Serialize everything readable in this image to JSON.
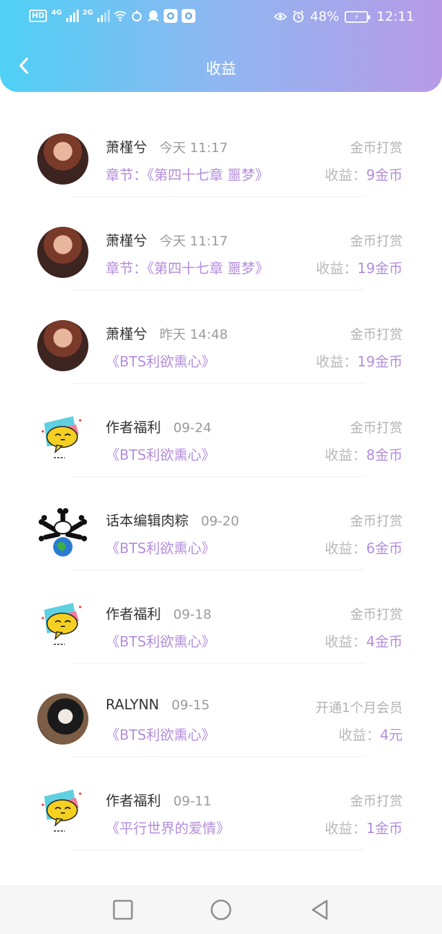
{
  "status_bar": {
    "left_tags": [
      "HD",
      "4G",
      "2G"
    ],
    "battery": "48%",
    "time": "12:11"
  },
  "header": {
    "title": "收益"
  },
  "items": [
    {
      "avatar": "photo-woman-1",
      "name": "萧槿兮",
      "time": "今天 11:17",
      "type": "金币打赏",
      "book": "章节：《第四十七章 噩梦》",
      "earn_label": "收益：",
      "earn_amount": "9金币"
    },
    {
      "avatar": "photo-woman-1",
      "name": "萧槿兮",
      "time": "今天 11:17",
      "type": "金币打赏",
      "book": "章节：《第四十七章 噩梦》",
      "earn_label": "收益：",
      "earn_amount": "19金币"
    },
    {
      "avatar": "photo-woman-1",
      "name": "萧槿兮",
      "time": "昨天 14:48",
      "type": "金币打赏",
      "book": "《BTS利欲熏心》",
      "earn_label": "收益：",
      "earn_amount": "19金币"
    },
    {
      "avatar": "yellow-sticker",
      "name": "作者福利",
      "time": "09-24",
      "type": "金币打赏",
      "book": "《BTS利欲熏心》",
      "earn_label": "收益：",
      "earn_amount": "8金币"
    },
    {
      "avatar": "earth-bones",
      "name": "话本编辑肉粽",
      "time": "09-20",
      "type": "金币打赏",
      "book": "《BTS利欲熏心》",
      "earn_label": "收益：",
      "earn_amount": "6金币"
    },
    {
      "avatar": "yellow-sticker",
      "name": "作者福利",
      "time": "09-18",
      "type": "金币打赏",
      "book": "《BTS利欲熏心》",
      "earn_label": "收益：",
      "earn_amount": "4金币"
    },
    {
      "avatar": "photo-woman-2",
      "name": "RALYNN",
      "time": "09-15",
      "type": "开通1个月会员",
      "book": "《BTS利欲熏心》",
      "earn_label": "收益：",
      "earn_amount": "4元"
    },
    {
      "avatar": "yellow-sticker",
      "name": "作者福利",
      "time": "09-11",
      "type": "金币打赏",
      "book": "《平行世界的爱情》",
      "earn_label": "收益：",
      "earn_amount": "1金币"
    }
  ],
  "colors": {
    "accent_purple": "#b38ddb",
    "header_gradient_start": "#4fd0f5",
    "header_gradient_end": "#b89ae8"
  },
  "nav_icons": [
    "recent-apps-icon",
    "home-icon",
    "back-icon"
  ]
}
